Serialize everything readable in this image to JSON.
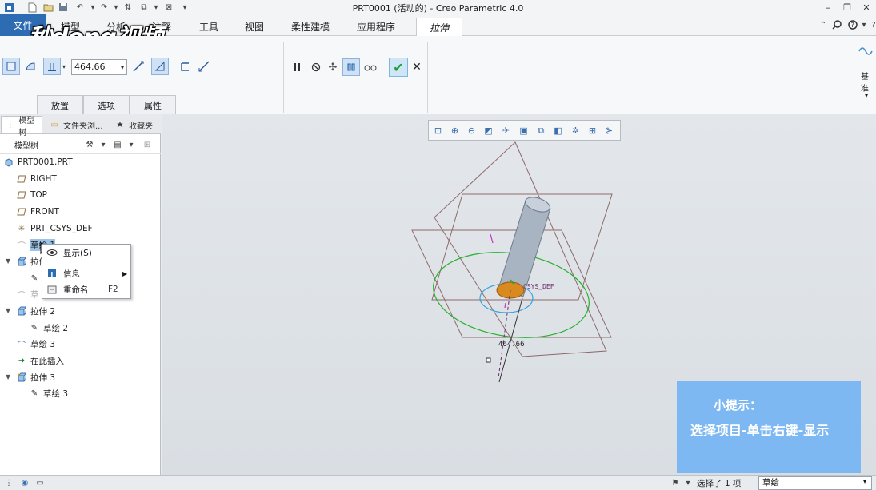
{
  "window": {
    "title": "PRT0001 (活动的) - Creo Parametric 4.0"
  },
  "quick_access": {
    "icons": [
      "new-icon",
      "open-icon",
      "save-icon",
      "undo-icon",
      "redo-icon",
      "regenerate-icon",
      "windows-icon",
      "close-window-icon",
      "customize-icon"
    ]
  },
  "menu": {
    "file": "文件",
    "tabs": [
      "模型",
      "分析",
      "注释",
      "工具",
      "视图",
      "柔性建模",
      "应用程序"
    ],
    "active_tab": "拉伸"
  },
  "watermark": "秒dong视频",
  "ribbon": {
    "depth_value": "464.66",
    "subtabs": [
      "放置",
      "选项",
      "属性"
    ],
    "datum_label": "基准"
  },
  "model_tree": {
    "panel_tabs": [
      "模型树",
      "文件夹浏...",
      "收藏夹"
    ],
    "toolbar_title": "模型树",
    "items": [
      {
        "label": "PRT0001.PRT",
        "icon": "part-icon"
      },
      {
        "label": "RIGHT",
        "icon": "datum-plane-icon"
      },
      {
        "label": "TOP",
        "icon": "datum-plane-icon"
      },
      {
        "label": "FRONT",
        "icon": "datum-plane-icon"
      },
      {
        "label": "PRT_CSYS_DEF",
        "icon": "csys-icon"
      },
      {
        "label": "草绘 1",
        "icon": "sketch-hidden-icon"
      },
      {
        "label": "拉伸 1",
        "icon": "extrude-icon"
      },
      {
        "label": "",
        "icon": "sketch-icon"
      },
      {
        "label": "草",
        "icon": "sketch-hidden-icon"
      },
      {
        "label": "拉伸 2",
        "icon": "extrude-icon"
      },
      {
        "label": "草绘 2",
        "icon": "sketch-icon"
      },
      {
        "label": "草绘 3",
        "icon": "sketch-curve-icon"
      },
      {
        "label": "在此插入",
        "icon": "insert-arrow-icon"
      },
      {
        "label": "拉伸 3",
        "icon": "extrude-new-icon"
      },
      {
        "label": "草绘 3",
        "icon": "sketch-new-icon"
      }
    ]
  },
  "context_menu": {
    "items": [
      {
        "label": "显示(S)",
        "shortcut": "",
        "icon": "show-eye-icon"
      },
      {
        "label": "信息",
        "shortcut": "",
        "icon": "info-icon"
      },
      {
        "label": "重命名",
        "shortcut": "F2",
        "icon": "rename-icon"
      }
    ]
  },
  "graphics": {
    "csys_label": "CSYS_DEF",
    "dimension_label": "464.66"
  },
  "tip": {
    "title": "小提示：",
    "body": "选择项目-单击右键-显示"
  },
  "status": {
    "selection_text": "选择了 1 项",
    "filter_value": "草绘"
  },
  "colors": {
    "file_tab": "#2d6bb3",
    "tip_bg": "#7db8f3",
    "ok_green": "#1f9a3a"
  }
}
